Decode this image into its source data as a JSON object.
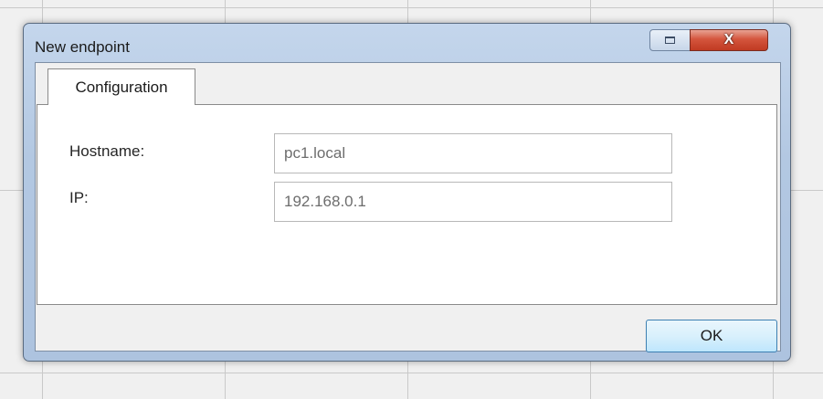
{
  "window": {
    "title": "New endpoint",
    "close_glyph": "X",
    "icons": {
      "maximize": "maximize-icon",
      "close": "close-icon"
    }
  },
  "tabs": [
    {
      "label": "Configuration"
    }
  ],
  "form": {
    "hostname_label": "Hostname:",
    "hostname_value": "pc1.local",
    "ip_label": "IP:",
    "ip_value": "192.168.0.1"
  },
  "buttons": {
    "ok": "OK"
  },
  "colors": {
    "accent": "#3c7fb1",
    "close": "#c03a22",
    "frame": "#b3c8e2"
  }
}
